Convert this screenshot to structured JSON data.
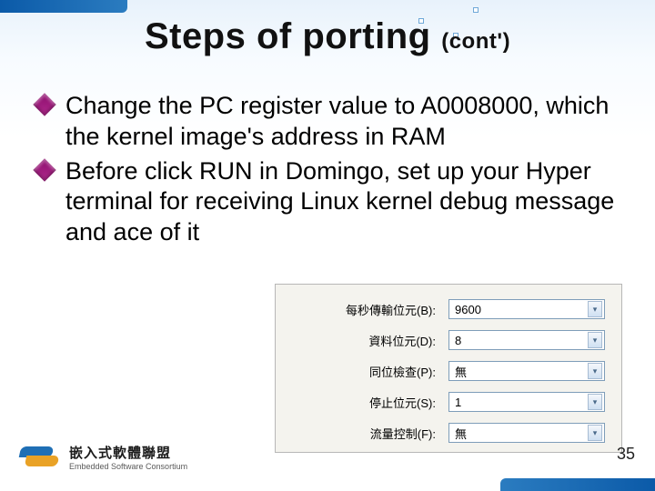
{
  "slide": {
    "title_main": "Steps of porting",
    "title_cont": "(cont')",
    "bullets": [
      "Change the PC register value to A0008000, which the kernel image's address in RAM",
      "Before click RUN in Domingo, set up your Hyper terminal for receiving Linux kernel debug message and                                    ace of it"
    ],
    "page_number": "35"
  },
  "dialog": {
    "rows": [
      {
        "label": "每秒傳輸位元(B):",
        "value": "9600"
      },
      {
        "label": "資料位元(D):",
        "value": "8"
      },
      {
        "label": "同位檢查(P):",
        "value": "無"
      },
      {
        "label": "停止位元(S):",
        "value": "1"
      },
      {
        "label": "流量控制(F):",
        "value": "無"
      }
    ]
  },
  "logo": {
    "cn": "嵌入式軟體聯盟",
    "en": "Embedded Software Consortium"
  }
}
